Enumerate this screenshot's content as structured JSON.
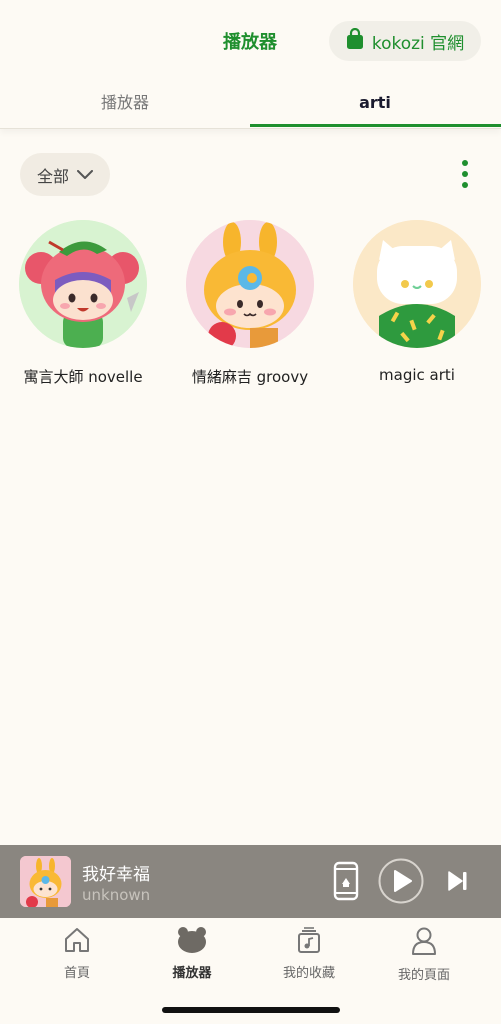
{
  "header": {
    "title": "播放器",
    "shop_label": "kokozi 官網"
  },
  "tabs": [
    {
      "label": "播放器",
      "active": false
    },
    {
      "label": "arti",
      "active": true
    }
  ],
  "filter": {
    "selected": "全部"
  },
  "cards": [
    {
      "label": "寓言大師 novelle",
      "bg": "#d8f3d1"
    },
    {
      "label": "情緒麻吉 groovy",
      "bg": "#f7d9e1"
    },
    {
      "label": "magic arti",
      "bg": "#fbe8c7"
    }
  ],
  "now_playing": {
    "title": "我好幸福",
    "artist": "unknown"
  },
  "nav": [
    {
      "label": "首頁",
      "icon": "home-icon",
      "active": false
    },
    {
      "label": "播放器",
      "icon": "bear-icon",
      "active": true
    },
    {
      "label": "我的收藏",
      "icon": "collection-icon",
      "active": false
    },
    {
      "label": "我的頁面",
      "icon": "profile-icon",
      "active": false
    }
  ],
  "colors": {
    "accent": "#1f8f2e",
    "background": "#fdfaf4",
    "player_bar": "#8a8680"
  }
}
